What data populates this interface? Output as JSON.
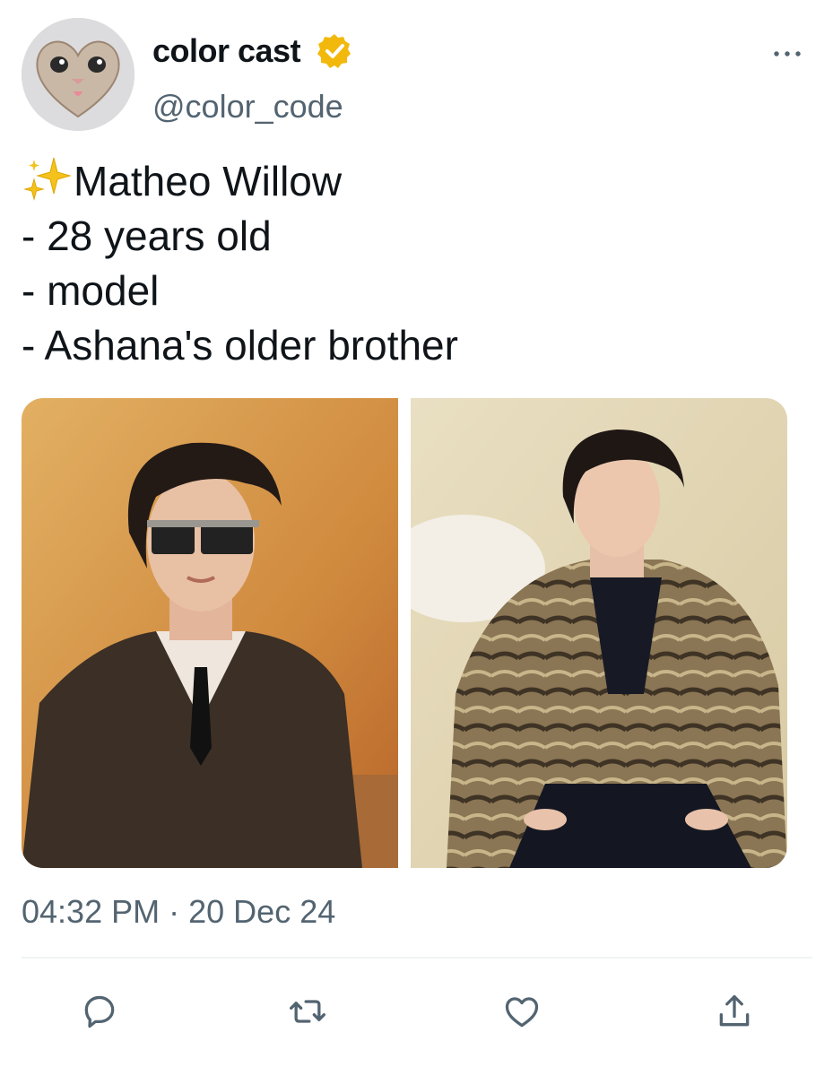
{
  "author": {
    "display_name": "color cast",
    "handle": "@color_code",
    "verified": true,
    "avatar_icon": "cat-heart-avatar",
    "verified_badge_color": "#f2b90c"
  },
  "tweet": {
    "emoji": "sparkles",
    "lines": [
      "Matheo Willow",
      "- 28 years old",
      "- model",
      "- Ashana's older brother"
    ]
  },
  "media": [
    {
      "name": "photo-suit-sunglasses"
    },
    {
      "name": "photo-fur-coat"
    }
  ],
  "meta": {
    "time": "04:32 PM",
    "separator": "·",
    "date": "20 Dec 24"
  },
  "actions": [
    {
      "icon": "reply-icon"
    },
    {
      "icon": "retweet-icon"
    },
    {
      "icon": "like-icon"
    },
    {
      "icon": "share-icon"
    }
  ],
  "colors": {
    "text": "#0f1419",
    "secondary": "#536471",
    "divider": "#eff3f4"
  }
}
